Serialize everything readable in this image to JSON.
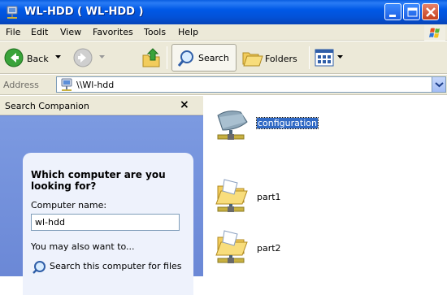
{
  "window": {
    "title": "WL-HDD ( WL-HDD )"
  },
  "menu": [
    "File",
    "Edit",
    "View",
    "Favorites",
    "Tools",
    "Help"
  ],
  "toolbar": {
    "back_label": "Back",
    "search_label": "Search",
    "folders_label": "Folders"
  },
  "address": {
    "label": "Address",
    "value": "\\\\Wl-hdd"
  },
  "search_panel": {
    "title": "Search Companion",
    "close_glyph": "×",
    "heading": "Which computer are you looking for?",
    "field_label": "Computer name:",
    "field_value": "wl-hdd",
    "also_label": "You may also want to...",
    "link_label": "Search this computer for files"
  },
  "content": {
    "items": [
      {
        "label": "configuration",
        "icon": "network-share-icon",
        "selected": true
      },
      {
        "label": "part1",
        "icon": "shared-folder-icon",
        "selected": false
      },
      {
        "label": "part2",
        "icon": "shared-folder-icon",
        "selected": false
      }
    ]
  },
  "colors": {
    "titlebar": "#0058e6",
    "panel": "#6b88d6",
    "selection": "#316ac5"
  }
}
